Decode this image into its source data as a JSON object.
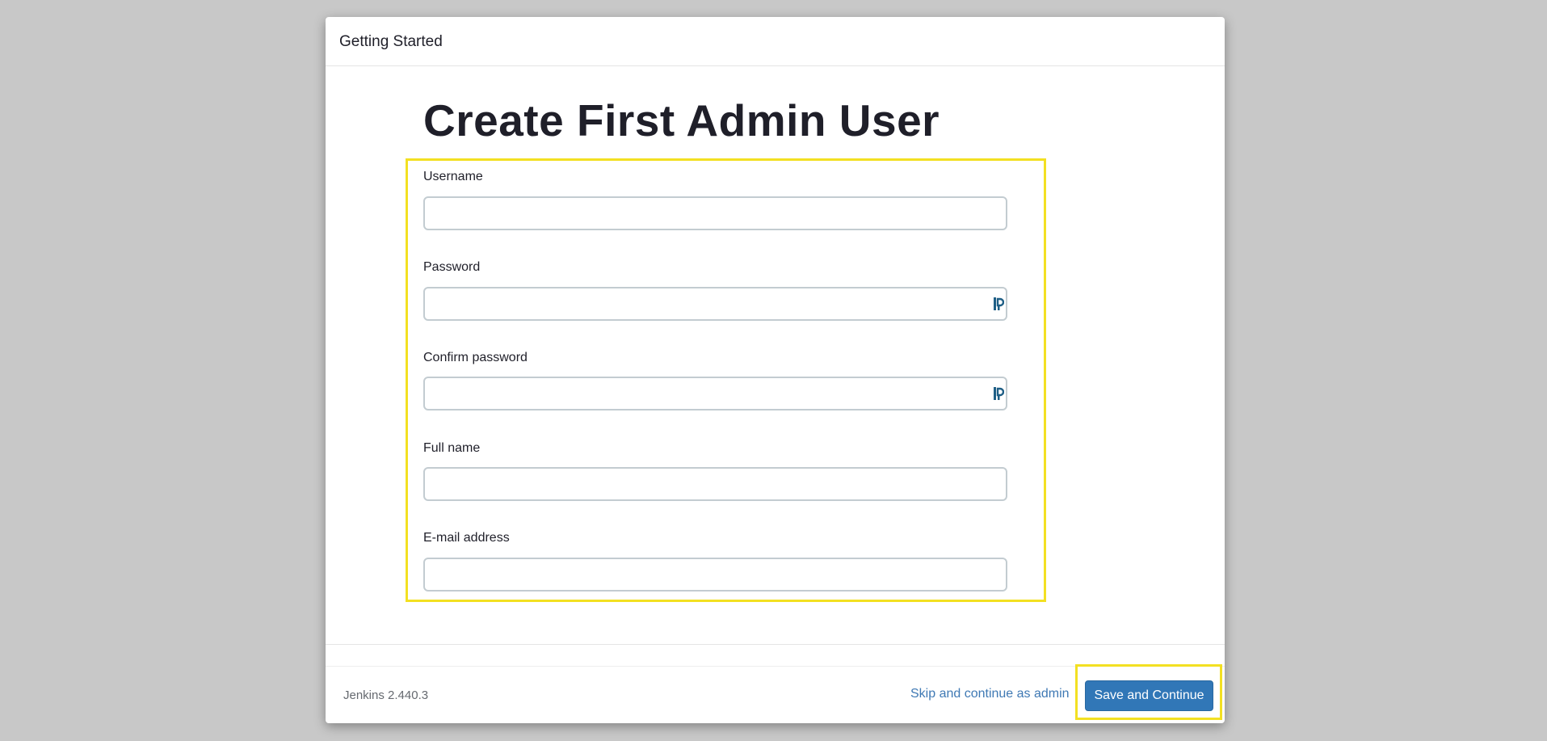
{
  "dialog": {
    "title": "Getting Started"
  },
  "page": {
    "title": "Create First Admin User"
  },
  "form": {
    "fields": [
      {
        "label": "Username",
        "value": "",
        "placeholder": ""
      },
      {
        "label": "Password",
        "value": "",
        "placeholder": ""
      },
      {
        "label": "Confirm password",
        "value": "",
        "placeholder": ""
      },
      {
        "label": "Full name",
        "value": "",
        "placeholder": ""
      },
      {
        "label": "E-mail address",
        "value": "",
        "placeholder": ""
      }
    ]
  },
  "footer": {
    "version": "Jenkins 2.440.3",
    "skip_label": "Skip and continue as admin",
    "save_label": "Save and Continue"
  },
  "icons": {
    "password_manager": "password-manager-icon"
  },
  "colors": {
    "accent": "#3177b7",
    "link": "#3f79b4",
    "highlight": "#f3e022"
  }
}
